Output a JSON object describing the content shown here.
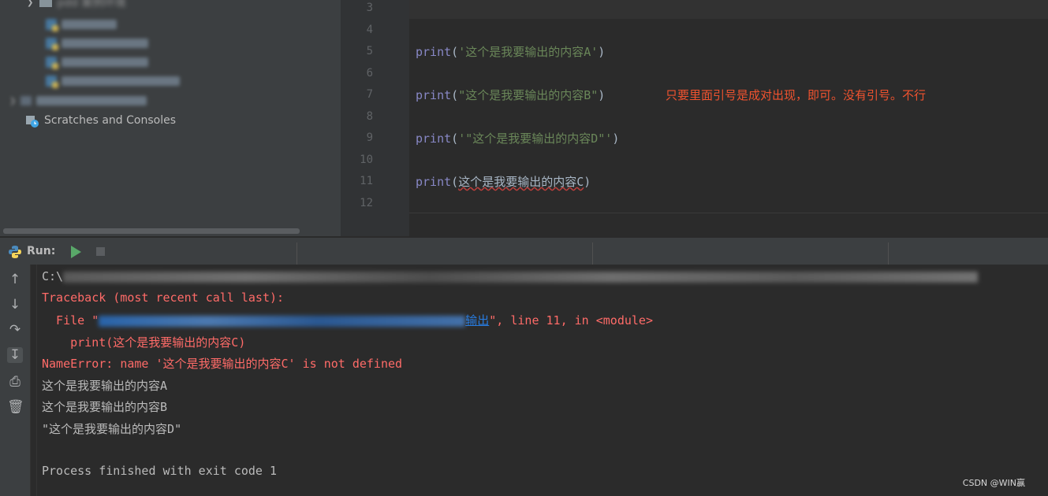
{
  "project": {
    "top_folder_label": "pdd 案例环境",
    "scratches_label": "Scratches and Consoles"
  },
  "editor": {
    "line_numbers": [
      "3",
      "4",
      "5",
      "6",
      "7",
      "8",
      "9",
      "10",
      "11",
      "12"
    ],
    "lines": [
      {
        "fn": "print",
        "open": "(",
        "arg": "'这个是我要输出的内容A'",
        "close": ")"
      },
      {
        "fn": "print",
        "open": "(",
        "arg": "\"这个是我要输出的内容B\"",
        "close": ")"
      },
      {
        "fn": "print",
        "open": "(",
        "arg": "'\"这个是我要输出的内容D\"'",
        "close": ")"
      },
      {
        "fn": "print",
        "open": "(",
        "arg": "这个是我要输出的内容C",
        "close": ")"
      }
    ],
    "annotation": "只要里面引号是成对出现，即可。没有引号。不行"
  },
  "run": {
    "title": "Run:"
  },
  "console": {
    "cmd_prefix": "C:\\",
    "traceback": "Traceback (most recent call last):",
    "file_prefix": "  File \"",
    "file_link_tail": "输出",
    "file_suffix": "\", line 11, in <module>",
    "code_line": "    print(这个是我要输出的内容C)",
    "error": "NameError: name '这个是我要输出的内容C' is not defined",
    "out1": "这个是我要输出的内容A",
    "out2": "这个是我要输出的内容B",
    "out3": "\"这个是我要输出的内容D\"",
    "finished": "Process finished with exit code 1"
  },
  "watermark": "CSDN @WIN赢"
}
